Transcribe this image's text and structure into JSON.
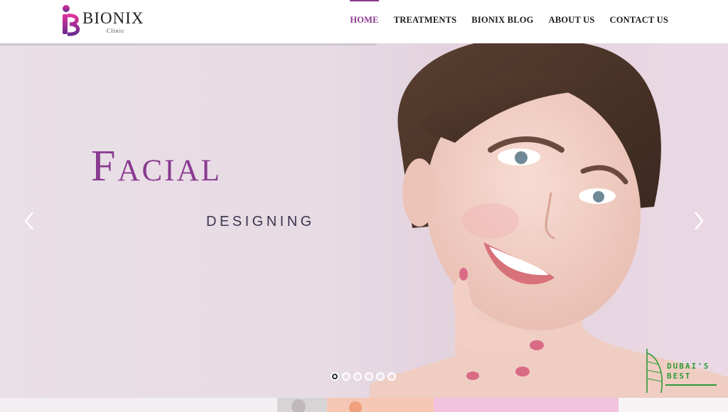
{
  "brand": {
    "name": "BIONIX",
    "sub": "Clinic"
  },
  "nav": {
    "items": [
      {
        "label": "HOME",
        "active": true
      },
      {
        "label": "TREATMENTS",
        "active": false
      },
      {
        "label": "BIONIX BLOG",
        "active": false
      },
      {
        "label": "ABOUT US",
        "active": false
      },
      {
        "label": "CONTACT US",
        "active": false
      }
    ]
  },
  "hero": {
    "title": "Facial",
    "subtitle": "DESIGNING",
    "slide_count": 6,
    "active_slide": 1,
    "prev_icon": "chevron-left-icon",
    "next_icon": "chevron-right-icon"
  },
  "badge": {
    "line1": "DUBAI'S",
    "line2": "BEST"
  },
  "colors": {
    "accent": "#8a3a91",
    "badge": "#2f9b3a",
    "hero_bg": "#e9dfe6"
  }
}
